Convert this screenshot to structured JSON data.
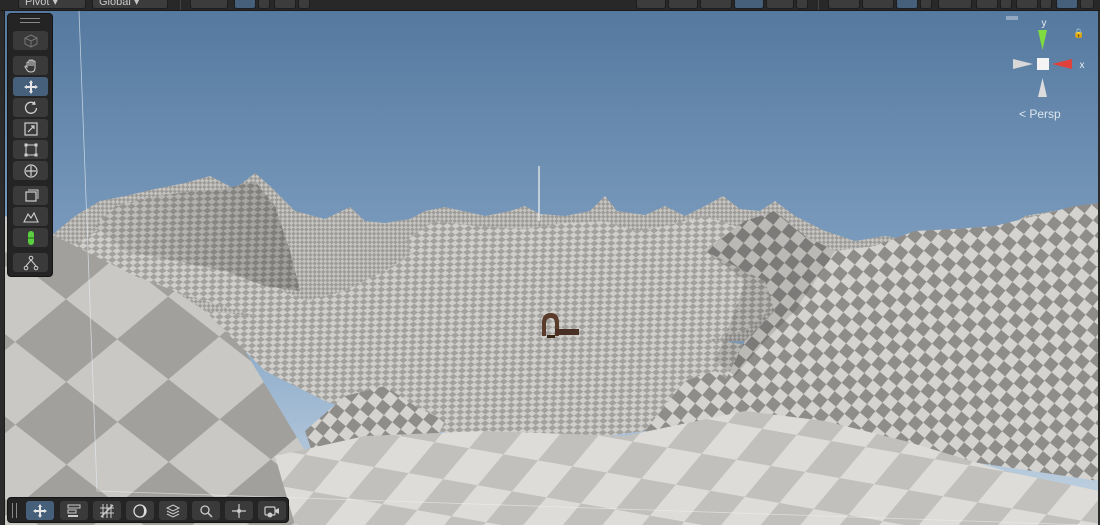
{
  "toolbar": {
    "pivot_label": "Pivot",
    "global_label": "Global",
    "grid_snap_value": ""
  },
  "tools": {
    "items": [
      {
        "name": "view-cube-tool",
        "icon": "cube-outline-icon",
        "selected": false
      },
      {
        "name": "hand-tool",
        "icon": "hand-icon",
        "selected": false
      },
      {
        "name": "move-tool",
        "icon": "move-arrows-icon",
        "selected": true
      },
      {
        "name": "rotate-tool",
        "icon": "rotate-icon",
        "selected": false
      },
      {
        "name": "scale-tool",
        "icon": "scale-icon",
        "selected": false
      },
      {
        "name": "rect-tool",
        "icon": "rect-transform-icon",
        "selected": false
      },
      {
        "name": "transform-tool",
        "icon": "transform-icon",
        "selected": false
      },
      {
        "name": "custom-tool",
        "icon": "layers-icon",
        "selected": false
      },
      {
        "name": "terrain-tool",
        "icon": "terrain-icon",
        "selected": false
      },
      {
        "name": "capsule-tool",
        "icon": "capsule-icon",
        "selected": false
      },
      {
        "name": "node-tool",
        "icon": "hierarchy-icon",
        "selected": false
      }
    ]
  },
  "overlay_bar": {
    "items": [
      {
        "name": "move-overlay",
        "icon": "move-arrows-icon"
      },
      {
        "name": "tool-settings-overlay",
        "icon": "sliders-icon"
      },
      {
        "name": "grid-snap-overlay",
        "icon": "grid-snap-icon"
      },
      {
        "name": "shading-overlay",
        "icon": "shading-sphere-icon"
      },
      {
        "name": "layers-overlay",
        "icon": "stack-icon"
      },
      {
        "name": "search-overlay",
        "icon": "search-icon"
      },
      {
        "name": "pivot-overlay",
        "icon": "pivot-icon"
      },
      {
        "name": "camera-overlay",
        "icon": "camera-icon"
      }
    ]
  },
  "gizmo": {
    "y_label": "y",
    "x_label": "x",
    "projection_label": "Persp",
    "colors": {
      "x": "#e0413a",
      "y": "#7fdc3f",
      "center": "#f0f0f0"
    }
  },
  "scene": {
    "sky_top": "#5a7fad",
    "sky_horizon": "#b9cde0",
    "terrain_light": "#c9c8c6",
    "terrain_dark": "#9a9896"
  }
}
